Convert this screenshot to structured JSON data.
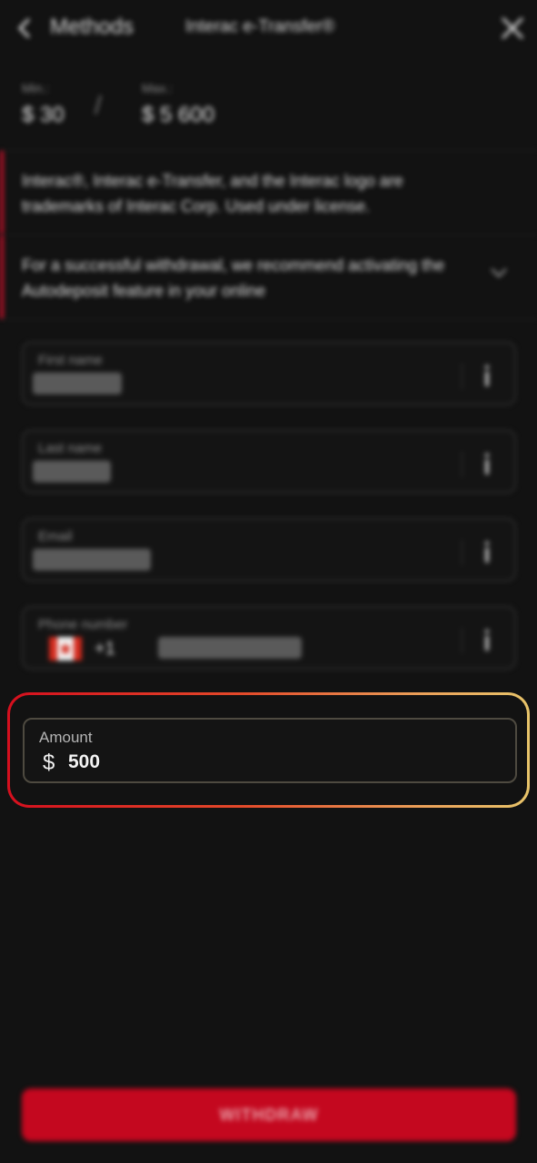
{
  "header": {
    "back_label": "Methods",
    "title": "Interac e-Transfer®"
  },
  "limits": {
    "min_label": "Min.:",
    "min_value": "$ 30",
    "separator": "/",
    "max_label": "Max.:",
    "max_value": "$ 5 600"
  },
  "notices": {
    "trademark": "Interac®, Interac e-Transfer, and the Interac logo are trademarks of Interac Corp. Used under license.",
    "recommendation": "For a successful withdrawal, we recommend activating the Autodeposit feature in your online"
  },
  "form": {
    "first_name_label": "First name",
    "last_name_label": "Last name",
    "email_label": "Email",
    "phone_label": "Phone number",
    "phone_code": "+1",
    "country_flag_icon": "canada-flag-icon",
    "amount_label": "Amount",
    "currency_symbol": "$",
    "amount_value": "500"
  },
  "actions": {
    "withdraw_label": "WITHDRAW"
  },
  "colors": {
    "background": "#121212",
    "accent_red": "#c4081f",
    "highlight_gradient_start": "#d50f1e",
    "highlight_gradient_end": "#e8c46a"
  }
}
